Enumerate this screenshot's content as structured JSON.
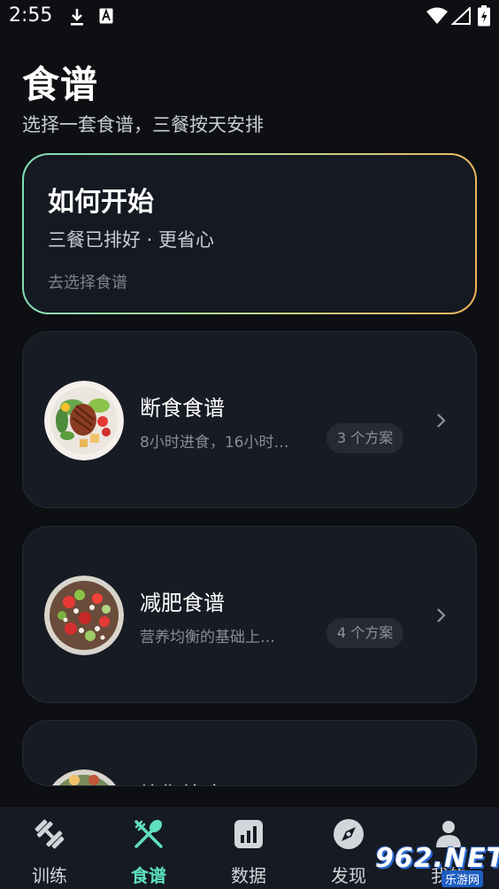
{
  "status_bar": {
    "time": "2:55"
  },
  "header": {
    "title": "食谱",
    "subtitle": "选择一套食谱，三餐按天安排"
  },
  "start_card": {
    "title": "如何开始",
    "subtitle": "三餐已排好 · 更省心",
    "link": "去选择食谱",
    "gradient": [
      "#7ee0b8",
      "#b9d98e",
      "#f2b35a"
    ]
  },
  "recipes": [
    {
      "name": "断食食谱",
      "desc": "8小时进食，16小时…",
      "plans": "3 个方案"
    },
    {
      "name": "减肥食谱",
      "desc": "营养均衡的基础上…",
      "plans": "4 个方案"
    },
    {
      "name": "均衡饮食",
      "desc": "",
      "plans": ""
    }
  ],
  "nav": {
    "items": [
      {
        "label": "训练",
        "icon": "dumbbell-icon"
      },
      {
        "label": "食谱",
        "icon": "fork-spoon-icon",
        "active": true
      },
      {
        "label": "数据",
        "icon": "chart-icon"
      },
      {
        "label": "发现",
        "icon": "compass-icon"
      },
      {
        "label": "我的",
        "icon": "person-icon"
      }
    ],
    "active_color": "#5ee0bd"
  },
  "watermark": {
    "text": "962.NET",
    "sub": "乐游网"
  }
}
